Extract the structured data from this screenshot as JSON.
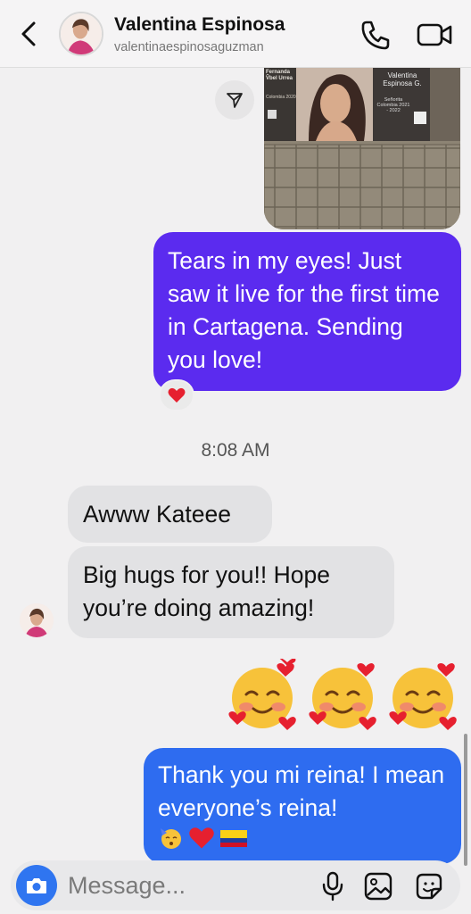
{
  "header": {
    "title": "Valentina Espinosa",
    "username": "valentinaespinosaguzman"
  },
  "photo": {
    "poster_left_name": "Fernanda Ṽbel Urrea",
    "poster_left_sub": "Colombia 2020",
    "poster_right_name": "Valentina Espinosa G.",
    "poster_right_sub": "Señorita Colombia 2021 - 2022"
  },
  "messages": {
    "sent_1": "Tears in my eyes! Just saw it live for the first time in Cartagena. Sending you love!",
    "sent_1_reaction": "❤️",
    "timestamp": "8:08 AM",
    "received_1": "Awww Kateee",
    "received_2": "Big hugs for you!! Hope you’re doing amazing!",
    "emoji_message": "🥰🥰🥰",
    "sent_2": "Thank you mi reina! I mean everyone’s reina!",
    "sent_2_emojis": "🥳❤️🇨🇴"
  },
  "composer": {
    "placeholder": "Message..."
  },
  "colors": {
    "sent_purple": "#5b2bef",
    "sent_blue": "#2e6cf0",
    "received_grey": "#e2e2e4",
    "camera_blue": "#2f75f0"
  },
  "icons": [
    "back-icon",
    "phone-icon",
    "video-icon",
    "share-icon",
    "heart-icon",
    "camera-icon",
    "microphone-icon",
    "gallery-icon",
    "sticker-icon"
  ]
}
